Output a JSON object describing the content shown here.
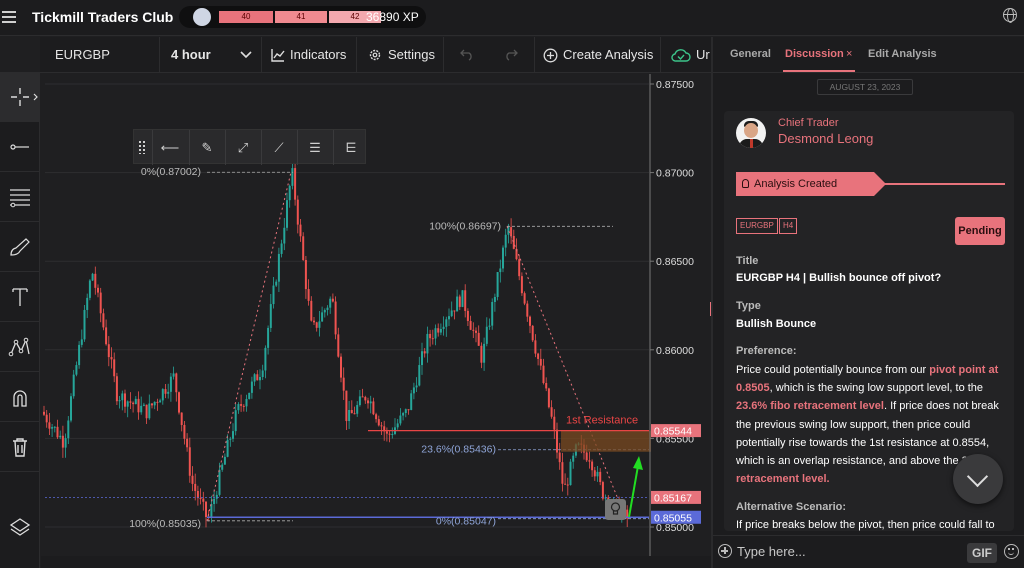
{
  "header": {
    "app_title": "Tickmill Traders Club",
    "levels": [
      "40",
      "41",
      "42"
    ],
    "xp": "36890 XP"
  },
  "toolbar": {
    "symbol": "EURGBP",
    "interval": "4 hour",
    "indicators": "Indicators",
    "settings": "Settings",
    "create_analysis": "Create Analysis",
    "cut_off": "Ur"
  },
  "chart_data": {
    "type": "candlestick",
    "y_axis_ticks": [
      "0.87500",
      "0.87000",
      "0.86500",
      "0.86000",
      "0.85500",
      "0.85000"
    ],
    "ylim": [
      0.85,
      0.875
    ],
    "price_tags": [
      {
        "value": "0.85544",
        "color": "#e8737c"
      },
      {
        "value": "0.85167",
        "color": "#e8737c"
      },
      {
        "value": "0.85055",
        "color": "#5b6ad8"
      }
    ],
    "fib_labels": [
      {
        "text": "0%(0.87002)",
        "price": 0.87002
      },
      {
        "text": "100%(0.85035)",
        "price": 0.85035
      },
      {
        "text": "100%(0.86697)",
        "price": 0.86697
      },
      {
        "text": "23.6%(0.85436)",
        "price": 0.85436
      },
      {
        "text": "0%(0.85047)",
        "price": 0.85047
      }
    ],
    "annotation": "1st Resistance",
    "colors": {
      "up": "#26a69a",
      "down": "#ef5350",
      "fib": "#e8737c",
      "support": "#5b6ad8"
    }
  },
  "panel": {
    "tabs": [
      "General",
      "Discussion",
      "Edit Analysis"
    ],
    "date": "AUGUST 23, 2023",
    "role": "Chief Trader",
    "name": "Desmond Leong",
    "ribbon": "Analysis Created",
    "tags": [
      "EURGBP",
      "H4"
    ],
    "status": "Pending",
    "title_label": "Title",
    "title_value": "EURGBP H4 | Bullish bounce off pivot?",
    "type_label": "Type",
    "type_value": "Bullish Bounce",
    "preference_label": "Preference:",
    "pref_parts": [
      "Price could potentially bounce from our ",
      "pivot point at 0.8505",
      ", which is the swing low support level, to the ",
      "23.6% fibo retracement level",
      ". If price does not break the previous swing low support, then price could potentially rise towards the ",
      "1st resistance at 0.8554",
      ", which is an overlap resistance, and above the 3",
      "fibo retracement level."
    ],
    "alt_label": "Alternative Scenario:",
    "alt_text": "If price breaks below the pivot, then price could fall to",
    "input_placeholder": "Type here...",
    "gif": "GIF"
  }
}
